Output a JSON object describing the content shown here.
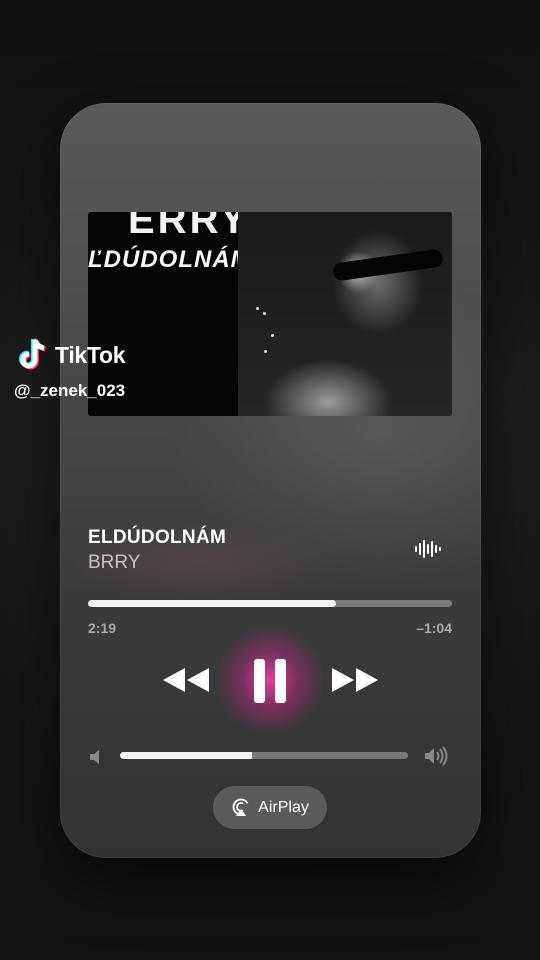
{
  "watermark": {
    "brand": "TikTok",
    "username": "@_zenek_023",
    "logo_icon": "tiktok-note-icon"
  },
  "artwork": {
    "top_letters": "ERRY",
    "text": "ĽDÚDOLNÁM"
  },
  "now_playing": {
    "title": "ELDÚDOLNÁM",
    "artist": "BRRY",
    "waveform_icon": "waveform-icon",
    "elapsed": "2:19",
    "remaining": "–1:04",
    "progress_fraction": 0.68
  },
  "controls": {
    "prev_icon": "rewind-icon",
    "play_icon": "pause-icon",
    "next_icon": "fast-forward-icon",
    "state": "playing"
  },
  "volume": {
    "min_icon": "speaker-low-icon",
    "max_icon": "speaker-high-icon",
    "level_fraction": 0.46
  },
  "airplay": {
    "label": "AirPlay",
    "icon": "airplay-icon"
  },
  "colors": {
    "accent_glow": "#ff3caa",
    "card": "#4a4a4a",
    "track": "#7a7a7a",
    "fill": "#f2f2f2"
  }
}
